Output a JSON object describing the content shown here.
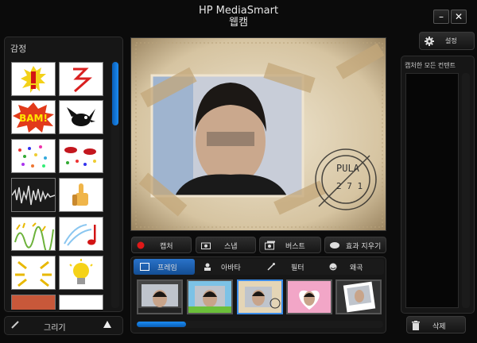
{
  "app": {
    "title": "HP MediaSmart",
    "subtitle": "웹캠"
  },
  "window_controls": {
    "minimize": "–",
    "close": "✕"
  },
  "left_panel": {
    "title": "감정",
    "draw_button": "그리기",
    "expand_icon": "triangle-up-icon"
  },
  "stickers": [
    "exclamation",
    "lightning",
    "bam",
    "bird",
    "confetti",
    "red-lips",
    "sound-wave",
    "thumbs-up",
    "angry-text",
    "music-note",
    "sparkle-burst",
    "light-bulb"
  ],
  "actions": [
    {
      "label": "캡처",
      "icon": "record-icon"
    },
    {
      "label": "스냅",
      "icon": "camera-icon"
    },
    {
      "label": "버스트",
      "icon": "burst-camera-icon"
    },
    {
      "label": "효과 지우기",
      "icon": "eraser-icon"
    }
  ],
  "tabs": [
    {
      "label": "프레임",
      "active": true
    },
    {
      "label": "아바타",
      "active": false
    },
    {
      "label": "필터",
      "active": false
    },
    {
      "label": "왜곡",
      "active": false
    }
  ],
  "frames": [
    {
      "style": "film",
      "selected": false
    },
    {
      "style": "cartoon",
      "selected": false
    },
    {
      "style": "vintage",
      "selected": true
    },
    {
      "style": "hearts",
      "selected": false
    },
    {
      "style": "polaroid",
      "selected": false
    }
  ],
  "right_panel": {
    "settings_label": "설정",
    "title": "캡처한 모든 컨텐트",
    "delete_label": "삭제"
  },
  "colors": {
    "accent": "#1b8cf4",
    "background": "#0b0b0b",
    "record": "#e01818"
  }
}
